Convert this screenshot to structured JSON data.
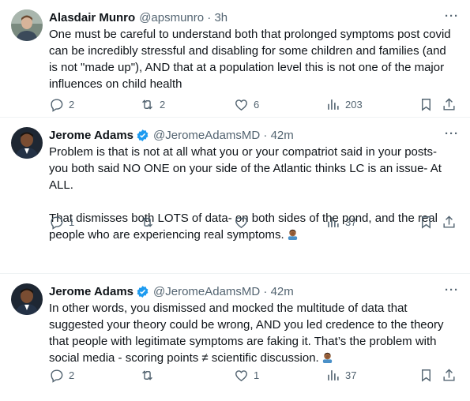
{
  "tweets": [
    {
      "name": "Alasdair Munro",
      "verified": false,
      "handle": "@apsmunro · 3h",
      "paragraphs": [
        "One must be careful to understand both that prolonged symptoms post covid can be incredibly stressful and disabling for some children and families (and is not \"made up\"), AND that at a population level this is not one of the major influences on child health"
      ],
      "replies": "2",
      "retweets": "2",
      "likes": "6",
      "views": "203"
    },
    {
      "name": "Jerome Adams",
      "verified": true,
      "handle": "@JeromeAdamsMD · 42m",
      "paragraphs": [
        "Problem is that is not at all what you or your compatriot said in your posts- you both said NO ONE on your side of the Atlantic thinks LC is an issue- At ALL.",
        "That dismisses both LOTS of data- on both sides of the pond, and the real people who are experiencing real symptoms."
      ],
      "replies": "1",
      "retweets": "",
      "likes": "",
      "views": "37"
    },
    {
      "name": "Jerome Adams",
      "verified": true,
      "handle": "@JeromeAdamsMD · 42m",
      "paragraphs": [
        "In other words, you dismissed and mocked the multitude of data that suggested your theory could be wrong, AND you led credence to the theory that people with legitimate symptoms are faking it. That’s the problem with social media - scoring points ≠ scientific discussion."
      ],
      "replies": "2",
      "retweets": "",
      "likes": "1",
      "views": "37"
    }
  ],
  "more_label": "···",
  "colors": {
    "verified": "#1d9bf0",
    "muted": "#536471",
    "text": "#0f1419"
  },
  "icons": [
    "reply-icon",
    "retweet-icon",
    "like-icon",
    "views-icon",
    "bookmark-icon",
    "share-icon",
    "verified-badge-icon",
    "facepalm-emoji-icon"
  ]
}
